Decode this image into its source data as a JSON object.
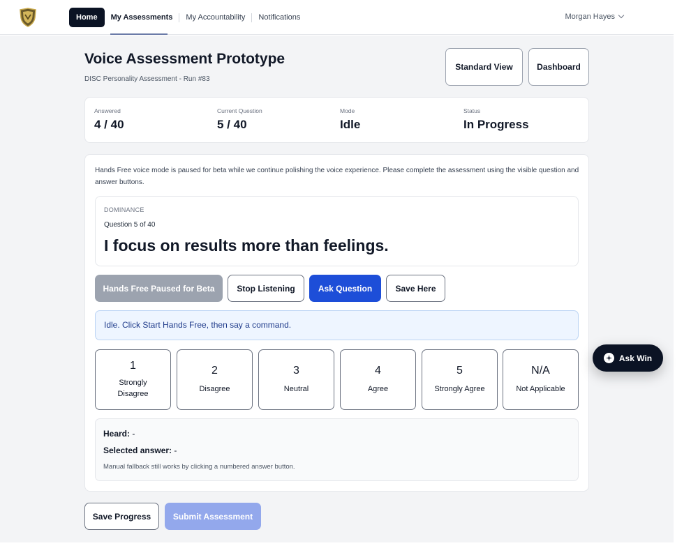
{
  "nav": {
    "items": [
      "Home",
      "My Assessments",
      "My Accountability",
      "Notifications"
    ],
    "user": "Morgan Hayes"
  },
  "header": {
    "title": "Voice Assessment Prototype",
    "subtitle": "DISC Personality Assessment - Run #83",
    "standard_view": "Standard View",
    "dashboard": "Dashboard"
  },
  "stats": [
    {
      "label": "Answered",
      "value": "4 / 40"
    },
    {
      "label": "Current Question",
      "value": "5 / 40"
    },
    {
      "label": "Mode",
      "value": "Idle"
    },
    {
      "label": "Status",
      "value": "In Progress"
    }
  ],
  "notice": "Hands Free voice mode is paused for beta while we continue polishing the voice experience. Please complete the assessment using the visible question and answer buttons.",
  "question": {
    "category": "DOMINANCE",
    "number": "Question 5 of 40",
    "text": "I focus on results more than feelings."
  },
  "actions": {
    "paused": "Hands Free Paused for Beta",
    "stop": "Stop Listening",
    "ask": "Ask Question",
    "save_here": "Save Here"
  },
  "status_message": "Idle. Click Start Hands Free, then say a command.",
  "options": [
    {
      "num": "1",
      "label": "Strongly Disagree"
    },
    {
      "num": "2",
      "label": "Disagree"
    },
    {
      "num": "3",
      "label": "Neutral"
    },
    {
      "num": "4",
      "label": "Agree"
    },
    {
      "num": "5",
      "label": "Strongly Agree"
    },
    {
      "num": "N/A",
      "label": "Not Applicable"
    }
  ],
  "heard": {
    "heard_label": "Heard:",
    "heard_value": "-",
    "selected_label": "Selected answer:",
    "selected_value": "-",
    "fallback": "Manual fallback still works by clicking a numbered answer button."
  },
  "footer": {
    "save_progress": "Save Progress",
    "submit": "Submit Assessment"
  },
  "ask_win": "Ask Win",
  "colors": {
    "nav_dark": "#0b1324",
    "primary": "#1d4ed8",
    "disabled_primary": "#93a8ec",
    "paused_gray": "#9ca3af",
    "page_bg": "#f3f4f6"
  }
}
